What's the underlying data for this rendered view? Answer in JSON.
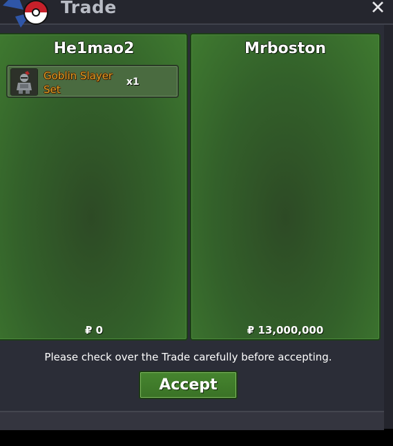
{
  "window": {
    "title": "Trade",
    "close_icon": "close-icon"
  },
  "left_panel": {
    "player_name": "He1mao2",
    "items": [
      {
        "name": "Goblin Slayer Set",
        "quantity": "x1",
        "icon": "goblin-slayer-armor-icon"
      }
    ],
    "money": "₽ 0"
  },
  "right_panel": {
    "player_name": "Mrboston",
    "items": [],
    "money": "₽ 13,000,000"
  },
  "notice": "Please check over the Trade carefully before accepting.",
  "accept_label": "Accept",
  "colors": {
    "panel_green": "#33612a",
    "item_name_orange": "#e0a024",
    "window_bg": "#2b2d37"
  }
}
